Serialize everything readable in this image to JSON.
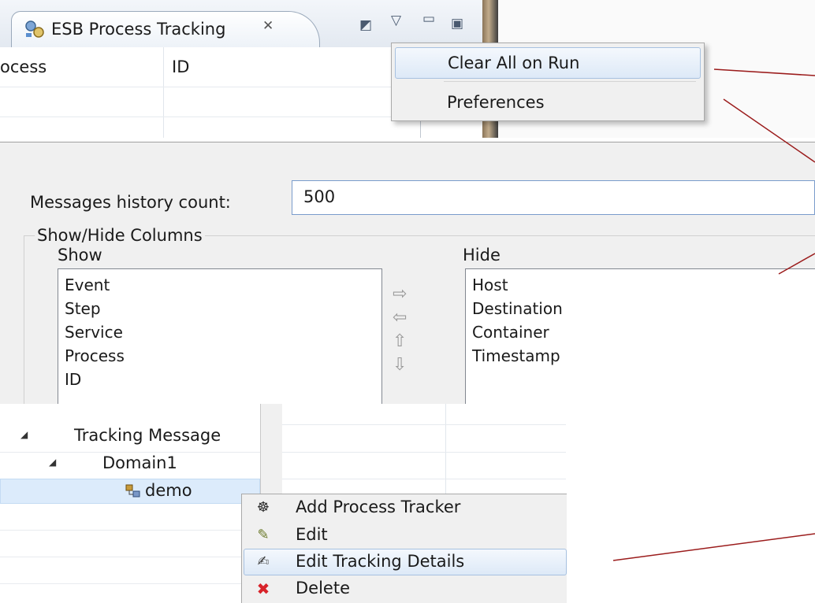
{
  "view": {
    "tab_title": "ESB Process Tracking",
    "columns": [
      "ocess",
      "ID"
    ]
  },
  "view_menu": {
    "items": [
      "Clear All on Run",
      "Preferences"
    ]
  },
  "preferences": {
    "history_label": "Messages history count:",
    "history_value": "500",
    "group_title": "Show/Hide Columns",
    "show_label": "Show",
    "hide_label": "Hide",
    "show_items": [
      "Event",
      "Step",
      "Service",
      "Process",
      "ID"
    ],
    "hide_items": [
      "Host",
      "Destination",
      "Container",
      "Timestamp"
    ]
  },
  "tree": {
    "root": "Tracking Message",
    "domain": "Domain1",
    "item": "demo"
  },
  "context_menu": {
    "items": [
      {
        "label": "Add Process Tracker",
        "icon": "process-tracker-icon"
      },
      {
        "label": "Edit",
        "icon": "pencil-icon"
      },
      {
        "label": "Edit Tracking Details",
        "icon": "tracking-details-icon"
      },
      {
        "label": "Delete",
        "icon": "red-x-icon"
      }
    ]
  },
  "colors": {
    "callout_line": "#9b1c1c",
    "highlight": "#dde9f7",
    "delete_red": "#d8232a"
  }
}
